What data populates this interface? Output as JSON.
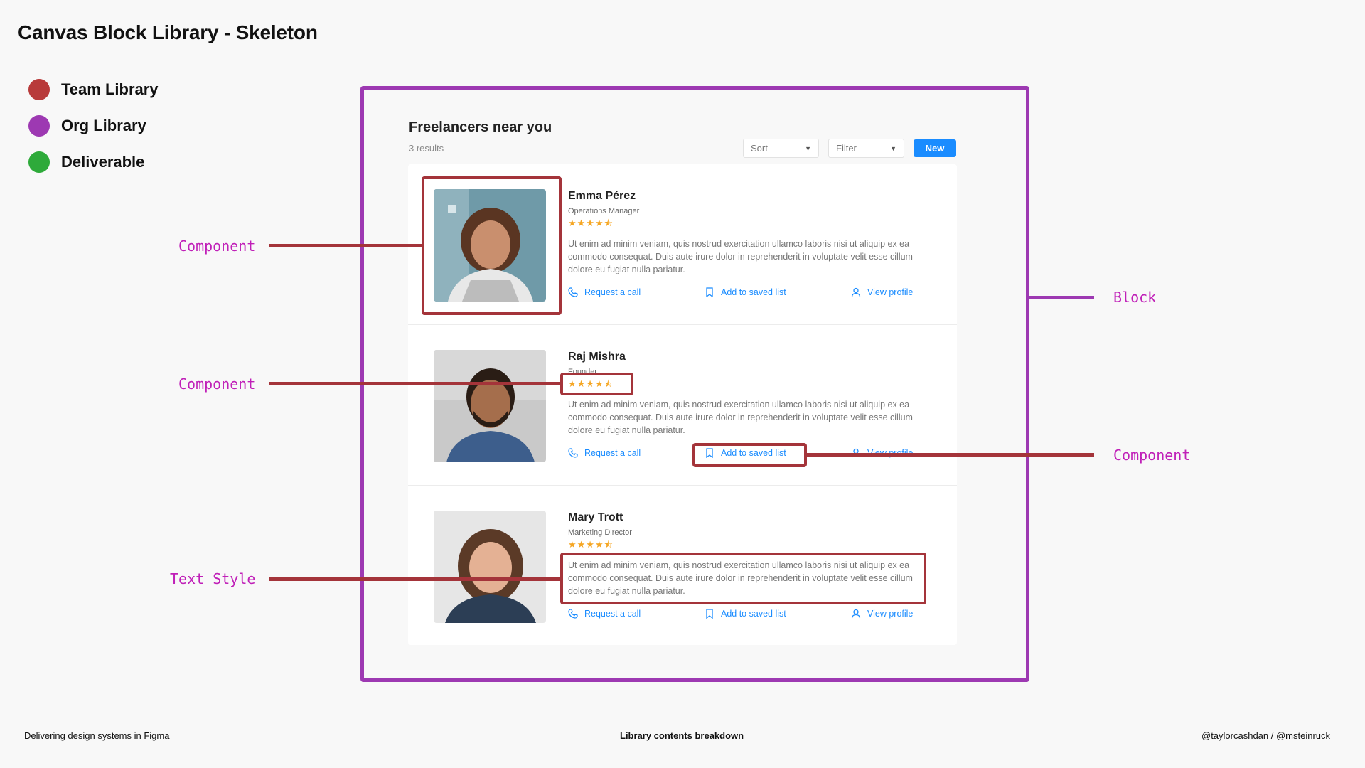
{
  "page_title": "Canvas Block Library - Skeleton",
  "legend": [
    {
      "label": "Team Library",
      "color": "#b83a3a"
    },
    {
      "label": "Org Library",
      "color": "#9d39b2"
    },
    {
      "label": "Deliverable",
      "color": "#2eaa3a"
    }
  ],
  "panel": {
    "title": "Freelancers near you",
    "subtitle": "3 results",
    "sort_label": "Sort",
    "filter_label": "Filter",
    "new_label": "New"
  },
  "people": [
    {
      "name": "Emma Pérez",
      "role": "Operations Manager",
      "rating": 4.5,
      "stars": "★★★★⯪",
      "desc": "Ut enim ad minim veniam, quis nostrud exercitation ullamco laboris nisi ut aliquip ex ea commodo consequat. Duis aute irure dolor in reprehenderit in voluptate velit esse cillum dolore eu fugiat nulla pariatur."
    },
    {
      "name": "Raj Mishra",
      "role": "Founder",
      "rating": 4.5,
      "stars": "★★★★⯪",
      "desc": "Ut enim ad minim veniam, quis nostrud exercitation ullamco laboris nisi ut aliquip ex ea commodo consequat. Duis aute irure dolor in reprehenderit in voluptate velit esse cillum dolore eu fugiat nulla pariatur."
    },
    {
      "name": "Mary Trott",
      "role": "Marketing Director",
      "rating": 4.5,
      "stars": "★★★★⯪",
      "desc": "Ut enim ad minim veniam, quis nostrud exercitation ullamco laboris nisi ut aliquip ex ea commodo consequat. Duis aute irure dolor in reprehenderit in voluptate velit esse cillum dolore eu fugiat nulla pariatur."
    }
  ],
  "actions": {
    "call": "Request a call",
    "save": "Add to saved list",
    "profile": "View profile"
  },
  "callouts": {
    "component_1": "Component",
    "component_2": "Component",
    "component_3": "Component",
    "text_style": "Text Style",
    "block": "Block"
  },
  "footer": {
    "left": "Delivering design systems in Figma",
    "center": "Library contents breakdown",
    "right": "@taylorcashdan / @msteinruck"
  },
  "colors": {
    "team": "#b83a3a",
    "org": "#9d39b2",
    "deliverable": "#2eaa3a",
    "accent": "#1a8cff",
    "callout": "#c020b8"
  }
}
